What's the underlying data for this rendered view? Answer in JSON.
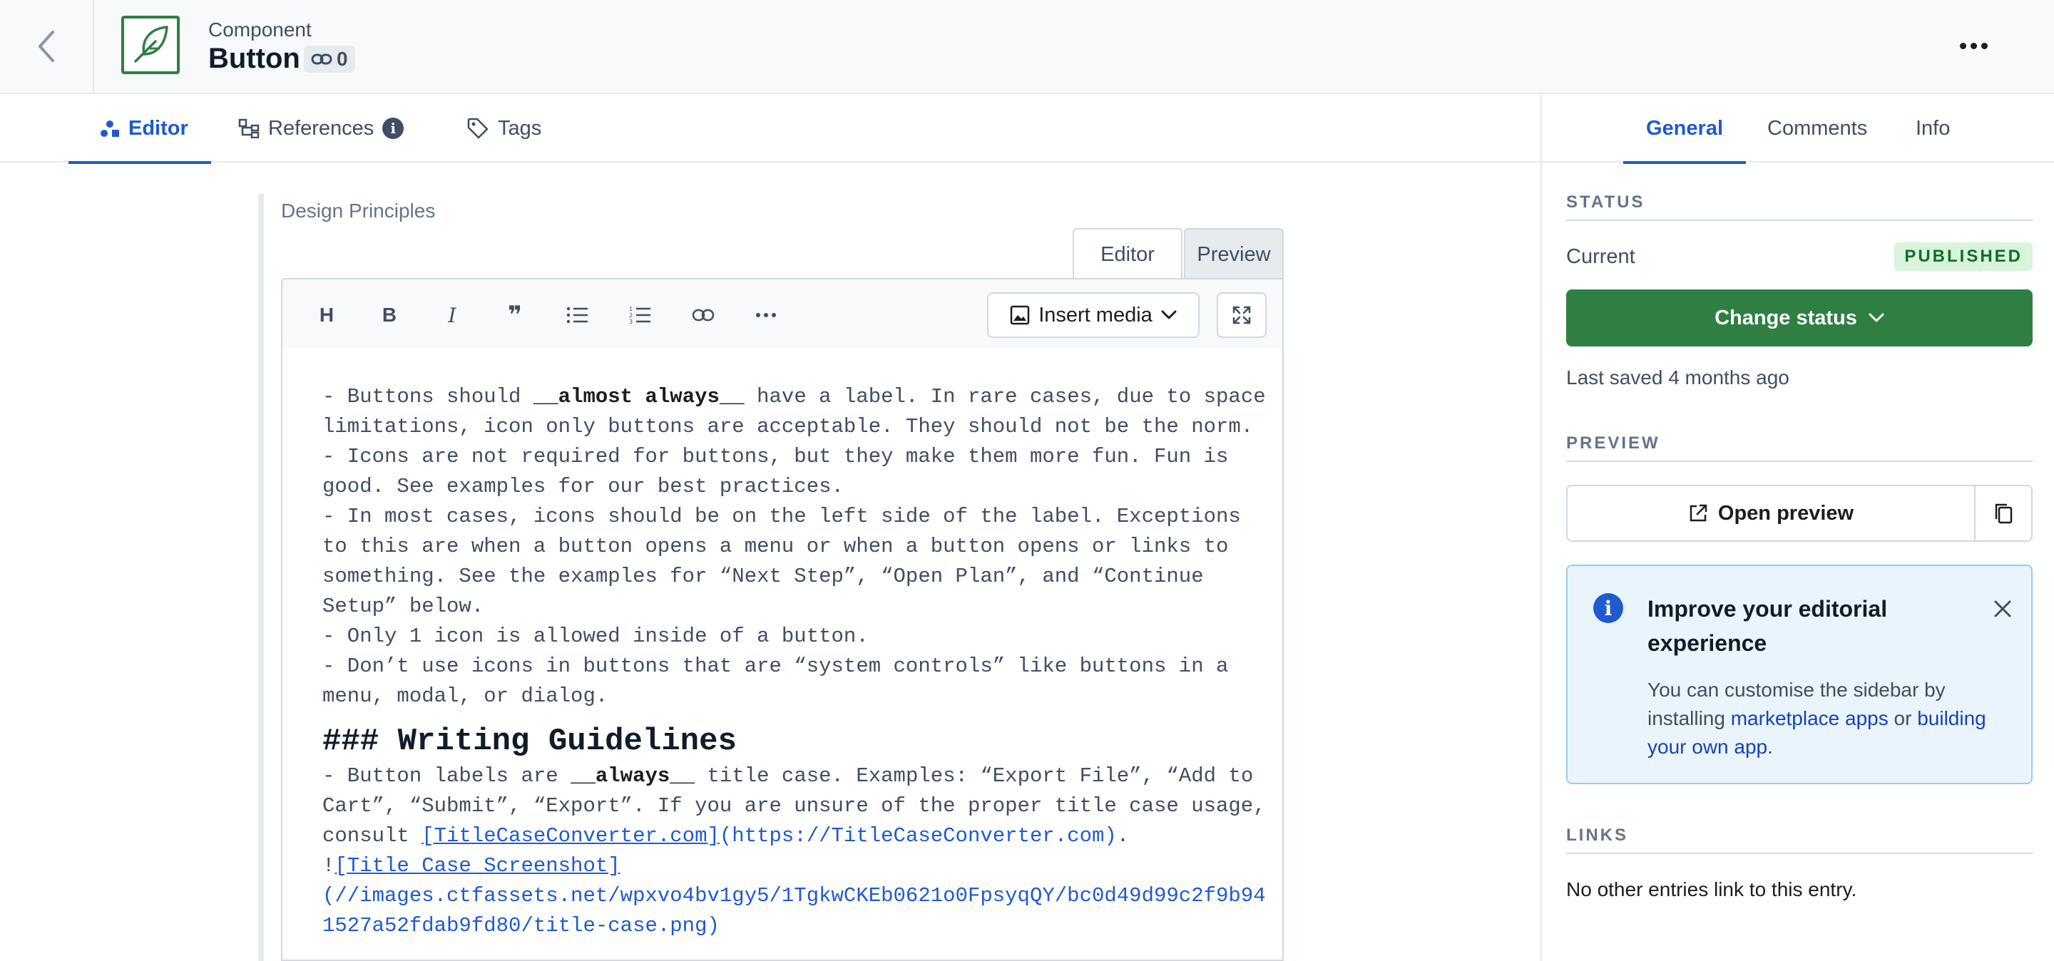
{
  "header": {
    "entry_type": "Component",
    "entry_title": "Button",
    "link_count": "0"
  },
  "tabs": [
    {
      "label": "Editor",
      "icon": "editor-icon"
    },
    {
      "label": "References",
      "icon": "references-icon"
    },
    {
      "label": "Tags",
      "icon": "tag-icon"
    }
  ],
  "field": {
    "label": "Design Principles",
    "mode_editor": "Editor",
    "mode_preview": "Preview"
  },
  "toolbar": {
    "heading": "H",
    "bold": "B",
    "italic": "I",
    "quote": "❞",
    "insert_media": "Insert media"
  },
  "content": {
    "l1a": "- Buttons should ",
    "l1b": "__almost always__",
    "l1c": " have a label. In rare cases, due to space",
    "l2": "limitations, icon only buttons are acceptable. They should not be the norm.",
    "l3": "- Icons are not required for buttons, but they make them more fun. Fun is",
    "l4": "good. See examples for our best practices.",
    "l5": "- In most cases, icons should be on the left side of the label. Exceptions",
    "l6": "to this are when a button opens a menu or when a button opens or links to",
    "l7": "something. See the examples for “Next Step”, “Open Plan”, and “Continue",
    "l8": "Setup” below.",
    "l9": "- Only 1 icon is allowed inside of a button.",
    "l10": "- Don’t use icons in buttons that are “system controls” like buttons in a",
    "l11": "menu, modal, or dialog.",
    "heading": "### Writing Guidelines",
    "w1a": "- Button labels are ",
    "w1b": "__always__",
    "w1c": " title case. Examples: “Export File”, “Add to",
    "w2": "Cart”, “Submit”, “Export”. If you are unsure of the proper title case usage,",
    "w3a": "consult ",
    "w3b": "[TitleCaseConverter.com]",
    "w3c": "(https://TitleCaseConverter.com)",
    "w3d": ".",
    "w4a": "!",
    "w4b": "[Title Case Screenshot]",
    "w5": "(//images.ctfassets.net/wpxvo4bv1gy5/1TgkwCKEb0621o0FpsyqQY/bc0d49d99c2f9b94",
    "w6": "1527a52fdab9fd80/title-case.png)"
  },
  "sidebar": {
    "tabs": [
      "General",
      "Comments",
      "Info"
    ],
    "status_heading": "STATUS",
    "status_label": "Current",
    "status_badge": "PUBLISHED",
    "change_status": "Change status",
    "last_saved": "Last saved 4 months ago",
    "preview_heading": "PREVIEW",
    "open_preview": "Open preview",
    "note_title": "Improve your editorial experience",
    "note_body_a": "You can customise the sidebar by installing ",
    "note_link1": "marketplace apps",
    "note_body_b": " or ",
    "note_link2": "building your own app",
    "note_body_c": ".",
    "links_heading": "LINKS",
    "links_text": "No other entries link to this entry."
  },
  "colors": {
    "accent": "#1f5ad1",
    "success": "#2f7f43",
    "badge_bg": "#d9f3dd"
  }
}
